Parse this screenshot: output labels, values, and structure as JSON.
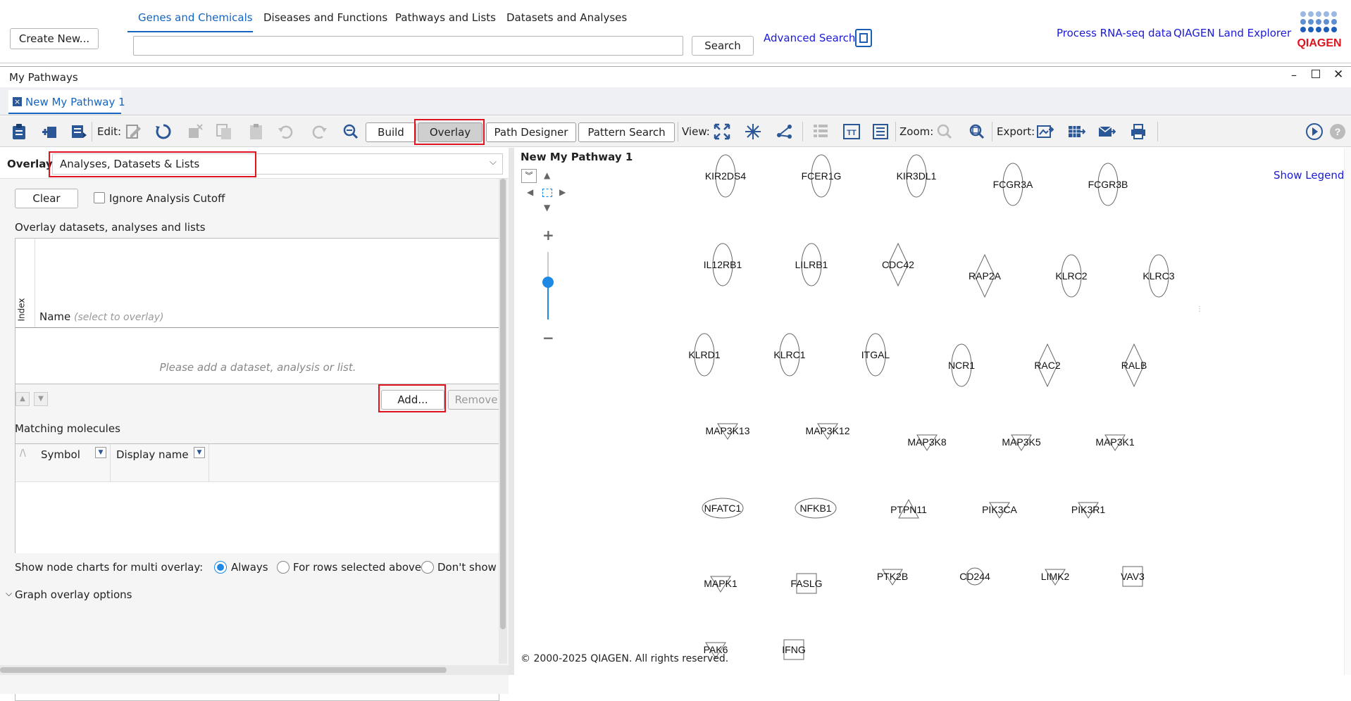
{
  "top": {
    "create_new": "Create New...",
    "tabs": [
      "Genes and Chemicals",
      "Diseases and Functions",
      "Pathways and Lists",
      "Datasets and Analyses"
    ],
    "search_value": "",
    "search_button": "Search",
    "advanced_search": "Advanced Search",
    "process_rnaseq": "Process RNA-seq data",
    "land_explorer": "QIAGEN Land Explorer",
    "logo_text": "QIAGEN"
  },
  "panel": {
    "title": "My Pathways",
    "tab": "New My Pathway 1",
    "window_controls": [
      "minimize-icon",
      "restore-icon",
      "close-icon"
    ]
  },
  "toolbar": {
    "edit_label": "Edit:",
    "build": "Build",
    "overlay": "Overlay",
    "path_designer": "Path Designer",
    "pattern_search": "Pattern Search",
    "view_label": "View:",
    "zoom_label": "Zoom:",
    "export_label": "Export:"
  },
  "left": {
    "overlay_label": "Overlay:",
    "overlay_value": "Analyses, Datasets & Lists",
    "clear": "Clear",
    "ignore_cutoff": "Ignore Analysis Cutoff",
    "section_title": "Overlay datasets, analyses and lists",
    "index_header": "Index",
    "name_header": "Name",
    "name_hint": "(select to overlay)",
    "empty_msg": "Please add a dataset, analysis or list.",
    "add": "Add...",
    "remove": "Remove",
    "matching_title": "Matching molecules",
    "symbol_header": "Symbol",
    "display_header": "Display name",
    "node_charts_label": "Show node charts for multi overlay:",
    "radio_options": [
      "Always",
      "For rows selected above",
      "Don't show"
    ],
    "radio_selected": "Always",
    "graph_options": "Graph overlay options"
  },
  "canvas": {
    "title": "New My Pathway 1",
    "show_legend": "Show Legend",
    "copyright": "© 2000-2025 QIAGEN. All rights reserved.",
    "zoom_level": 0.55,
    "genes": [
      {
        "label": "KIR2DS4",
        "shape": "ellipse"
      },
      {
        "label": "FCER1G",
        "shape": "ellipse"
      },
      {
        "label": "KIR3DL1",
        "shape": "ellipse"
      },
      {
        "label": "FCGR3A",
        "shape": "ellipse"
      },
      {
        "label": "FCGR3B",
        "shape": "ellipse"
      },
      {
        "label": "IL12RB1",
        "shape": "ellipse"
      },
      {
        "label": "LILRB1",
        "shape": "ellipse"
      },
      {
        "label": "CDC42",
        "shape": "diamond"
      },
      {
        "label": "RAP2A",
        "shape": "diamond"
      },
      {
        "label": "KLRC2",
        "shape": "ellipse"
      },
      {
        "label": "KLRC3",
        "shape": "ellipse"
      },
      {
        "label": "KLRD1",
        "shape": "ellipse"
      },
      {
        "label": "KLRC1",
        "shape": "ellipse"
      },
      {
        "label": "ITGAL",
        "shape": "ellipse"
      },
      {
        "label": "NCR1",
        "shape": "ellipse"
      },
      {
        "label": "RAC2",
        "shape": "diamond"
      },
      {
        "label": "RALB",
        "shape": "diamond"
      },
      {
        "label": "MAP3K13",
        "shape": "triangle-down"
      },
      {
        "label": "MAP3K12",
        "shape": "triangle-down"
      },
      {
        "label": "MAP3K8",
        "shape": "triangle-down"
      },
      {
        "label": "MAP3K5",
        "shape": "triangle-down"
      },
      {
        "label": "MAP3K1",
        "shape": "triangle-down"
      },
      {
        "label": "NFATC1",
        "shape": "ellipse-wide"
      },
      {
        "label": "NFKB1",
        "shape": "ellipse-wide"
      },
      {
        "label": "PTPN11",
        "shape": "triangle-up"
      },
      {
        "label": "PIK3CA",
        "shape": "triangle-down"
      },
      {
        "label": "PIK3R1",
        "shape": "triangle-down"
      },
      {
        "label": "MAPK1",
        "shape": "triangle-down"
      },
      {
        "label": "FASLG",
        "shape": "square"
      },
      {
        "label": "PTK2B",
        "shape": "triangle-down"
      },
      {
        "label": "CD244",
        "shape": "circle"
      },
      {
        "label": "LIMK2",
        "shape": "triangle-down"
      },
      {
        "label": "VAV3",
        "shape": "square"
      },
      {
        "label": "PAK6",
        "shape": "triangle-down"
      },
      {
        "label": "IFNG",
        "shape": "square"
      }
    ]
  },
  "colors": {
    "accent": "#1a1ad6",
    "tab_blue": "#1565c0",
    "highlight": "#e0141e",
    "slider": "#1e88e5"
  }
}
